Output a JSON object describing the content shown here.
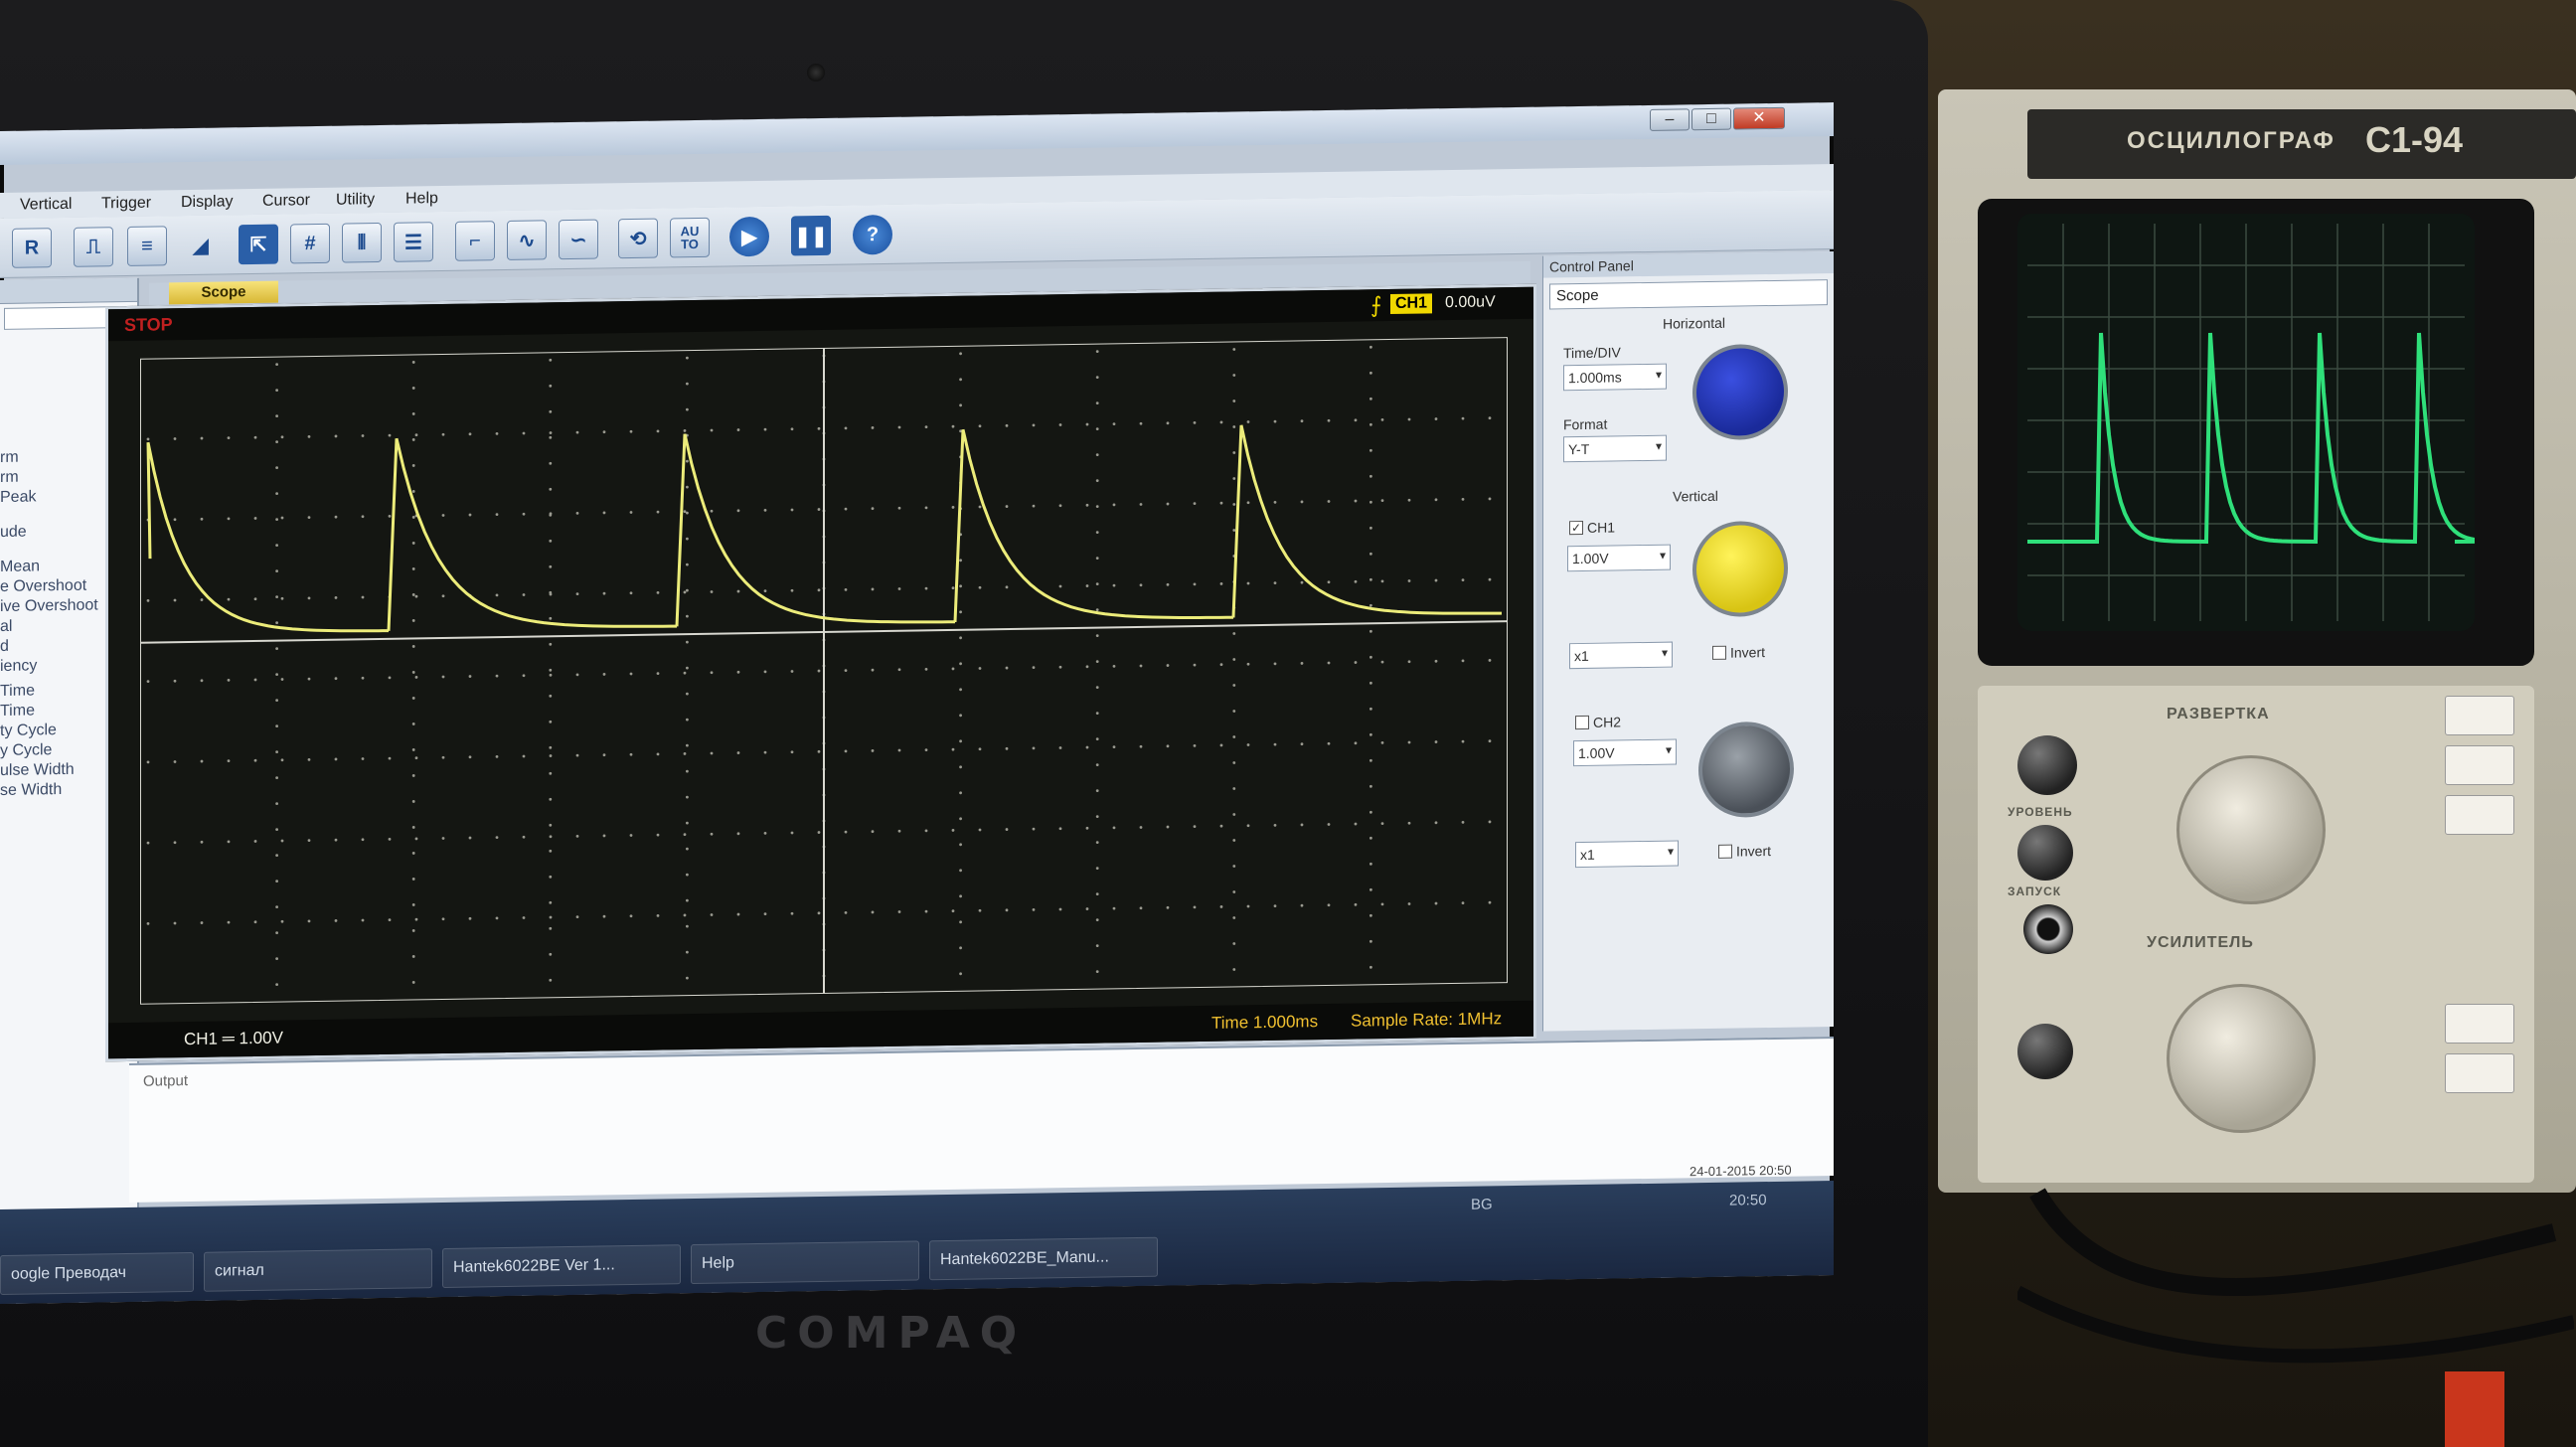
{
  "app": {
    "menu": [
      "Vertical",
      "Trigger",
      "Display",
      "Cursor",
      "Utility",
      "Help"
    ],
    "toolbar_icons": [
      "run-stop-icon",
      "rise-icon",
      "fall-icon",
      "ramp-icon",
      "cursor-icon",
      "grid-icon",
      "vbar-icon",
      "hbar-icon",
      "step-icon",
      "sine-icon",
      "wave-icon",
      "refresh-icon",
      "auto-icon",
      "play-icon",
      "pause-icon",
      "help-icon"
    ],
    "toolbar_auto": "AU\nTO",
    "toolbar_help": "?",
    "scope_tab": "Scope"
  },
  "left_panel": {
    "items": [
      "rm",
      "rm",
      "Peak",
      "ude",
      "Mean",
      "e Overshoot",
      "ive Overshoot",
      "al",
      "d",
      "iency",
      "Time",
      "Time",
      "ty Cycle",
      "y Cycle",
      "ulse Width",
      "se Width"
    ]
  },
  "scope": {
    "status": "STOP",
    "trigger_channel": "CH1",
    "trigger_level": "0.00uV",
    "time_label": "Time 1.000ms",
    "sample_rate": "Sample Rate: 1MHz",
    "ch_scale": "CH1 ═ 1.00V",
    "colors": {
      "trace": "#ecec7a",
      "grid": "#d8d8d0",
      "background": "#141612"
    }
  },
  "control_panel": {
    "title": "Control Panel",
    "selection": "Scope",
    "horizontal": "Horizontal",
    "time_div_label": "Time/DIV",
    "time_div_value": "1.000ms",
    "format_label": "Format",
    "format_value": "Y-T",
    "vertical": "Vertical",
    "ch1_label": "CH1",
    "ch1_volts": "1.00V",
    "ch1_probe": "x1",
    "ch1_invert": "Invert",
    "ch2_label": "CH2",
    "ch2_volts": "1.00V",
    "ch2_probe": "x1",
    "ch2_invert": "Invert"
  },
  "output": {
    "label": "Output",
    "datetime": "24-01-2015 20:50"
  },
  "taskbar": {
    "tasks": [
      "oogle Преводач",
      "сигнал",
      "Hantek6022BE Ver 1...",
      "Help",
      "Hantek6022BE_Manu..."
    ],
    "lang": "BG",
    "clock": "20:50"
  },
  "bezel": {
    "brand": "COMPAQ"
  },
  "analog_scope": {
    "title": "ОСЦИЛЛОГРАФ",
    "model": "С1-94",
    "sweep_label": "РАЗВЕРТКА",
    "amp_label": "УСИЛИТЕЛЬ",
    "level_label": "УРОВЕНЬ",
    "trigger_label": "ЗАПУСК",
    "trace_color": "#2fe07a"
  }
}
